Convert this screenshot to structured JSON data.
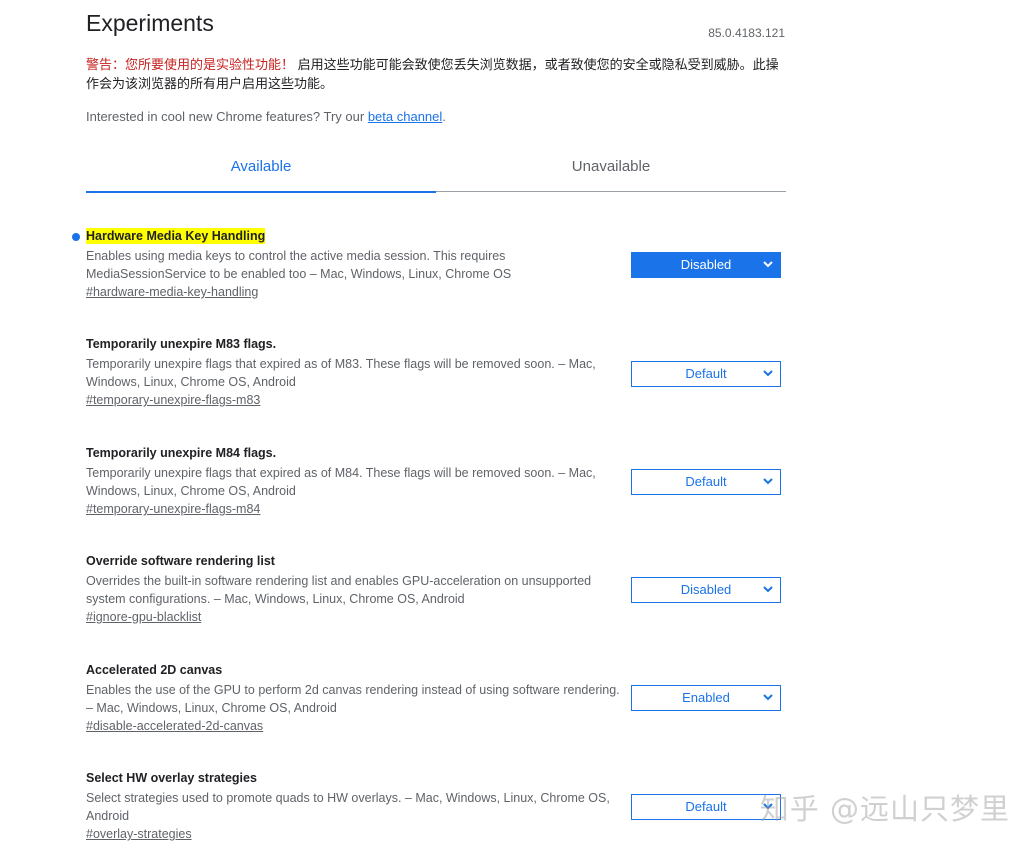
{
  "header": {
    "title": "Experiments",
    "version": "85.0.4183.121"
  },
  "warning": {
    "prefix": "警告：您所要使用的是实验性功能！",
    "body": "启用这些功能可能会致使您丢失浏览数据，或者致使您的安全或隐私受到威胁。此操作会为该浏览器的所有用户启用这些功能。"
  },
  "beta": {
    "text": "Interested in cool new Chrome features? Try our",
    "link": "beta channel",
    "suffix": "."
  },
  "tabs": [
    {
      "label": "Available",
      "active": true
    },
    {
      "label": "Unavailable",
      "active": false
    }
  ],
  "flags": [
    {
      "title": "Hardware Media Key Handling",
      "description": "Enables using media keys to control the active media session. This requires MediaSessionService to be enabled too – Mac, Windows, Linux, Chrome OS",
      "link": "#hardware-media-key-handling",
      "value": "Disabled",
      "modified": true
    },
    {
      "title": "Temporarily unexpire M83 flags.",
      "description": "Temporarily unexpire flags that expired as of M83. These flags will be removed soon. – Mac, Windows, Linux, Chrome OS, Android",
      "link": "#temporary-unexpire-flags-m83",
      "value": "Default",
      "modified": false
    },
    {
      "title": "Temporarily unexpire M84 flags.",
      "description": "Temporarily unexpire flags that expired as of M84. These flags will be removed soon. – Mac, Windows, Linux, Chrome OS, Android",
      "link": "#temporary-unexpire-flags-m84",
      "value": "Default",
      "modified": false
    },
    {
      "title": "Override software rendering list",
      "description": "Overrides the built-in software rendering list and enables GPU-acceleration on unsupported system configurations. – Mac, Windows, Linux, Chrome OS, Android",
      "link": "#ignore-gpu-blacklist",
      "value": "Disabled",
      "modified": false
    },
    {
      "title": "Accelerated 2D canvas",
      "description": "Enables the use of the GPU to perform 2d canvas rendering instead of using software rendering. – Mac, Windows, Linux, Chrome OS, Android",
      "link": "#disable-accelerated-2d-canvas",
      "value": "Enabled",
      "modified": false
    },
    {
      "title": "Select HW overlay strategies",
      "description": "Select strategies used to promote quads to HW overlays. – Mac, Windows, Linux, Chrome OS, Android",
      "link": "#overlay-strategies",
      "value": "Default",
      "modified": false
    }
  ],
  "watermark": "知乎 @远山只梦里",
  "colors": {
    "accent": "#1a73e8",
    "warning": "#c5221f",
    "highlight": "#ffff00"
  }
}
